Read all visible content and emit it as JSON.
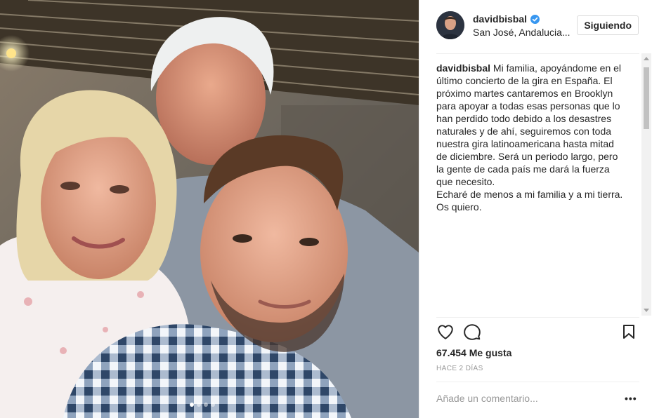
{
  "post": {
    "username": "davidbisbal",
    "location": "San José, Andalucia...",
    "follow_label": "Siguiendo",
    "caption_user": "davidbisbal",
    "caption_text": " Mi familia, apoyándome en el último concierto de la gira en España. El próximo martes cantaremos en Brooklyn para apoyar a todas esas personas que lo han perdido todo debido a los desastres naturales y de ahí, seguiremos con toda nuestra gira latinoamericana hasta mitad de diciembre. Será un periodo largo, pero la gente de cada país me dará la fuerza que necesito.\nEcharé de menos a mi familia y a mi tierra. Os quiero.",
    "likes": "67.454 Me gusta",
    "time_ago": "Hace 2 días",
    "comment_placeholder": "Añade un comentario...",
    "more_label": "•••"
  },
  "icons": {
    "verified": "verified-badge-icon",
    "like": "heart-icon",
    "comment": "comment-icon",
    "save": "bookmark-icon"
  },
  "colors": {
    "verified": "#3897f0",
    "text": "#262626",
    "muted": "#999999",
    "border": "#dbdbdb"
  },
  "carousel": {
    "count": 4,
    "active_index": 0
  }
}
